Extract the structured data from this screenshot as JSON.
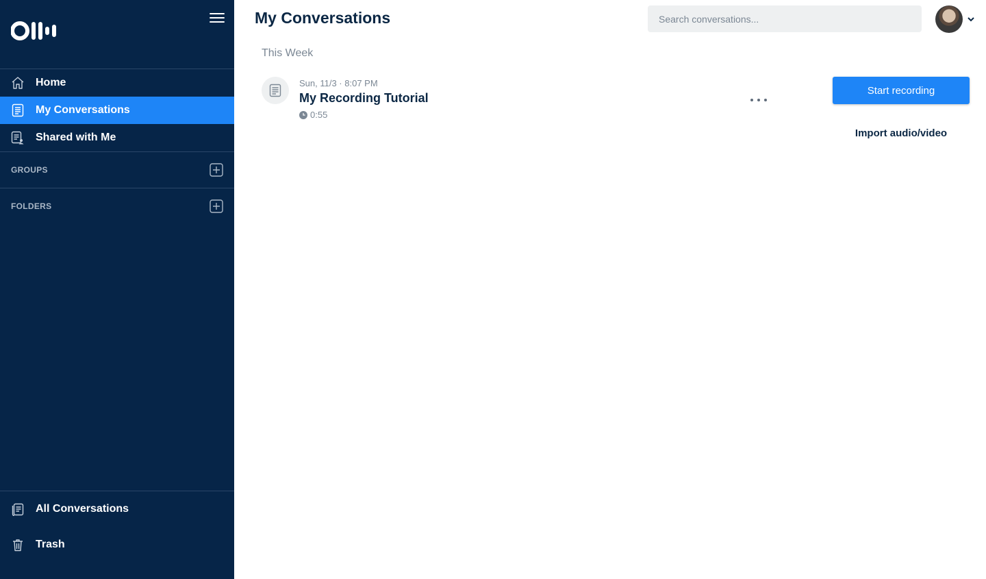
{
  "sidebar": {
    "logo_text": "Otter",
    "menu_icon": "hamburger-icon",
    "nav": [
      {
        "label": "Home",
        "icon": "home-icon"
      },
      {
        "label": "My Conversations",
        "icon": "document-icon"
      },
      {
        "label": "Shared with Me",
        "icon": "shared-document-icon"
      }
    ],
    "groups_label": "GROUPS",
    "folders_label": "FOLDERS",
    "bottom_nav": [
      {
        "label": "All Conversations",
        "icon": "documents-stack-icon"
      },
      {
        "label": "Trash",
        "icon": "trash-icon"
      }
    ]
  },
  "header": {
    "title": "My Conversations",
    "search_placeholder": "Search conversations...",
    "avatar_icon": "user-avatar"
  },
  "main": {
    "group_label": "This Week",
    "conversations": [
      {
        "date": "Sun, 11/3 · 8:07 PM",
        "title": "My Recording Tutorial",
        "duration": "0:55"
      }
    ],
    "actions": {
      "start_recording": "Start recording",
      "import": "Import audio/video"
    }
  },
  "colors": {
    "sidebar_bg": "#062548",
    "accent": "#1e85f7",
    "title_text": "#0b2744",
    "muted_text": "#7b8794"
  }
}
